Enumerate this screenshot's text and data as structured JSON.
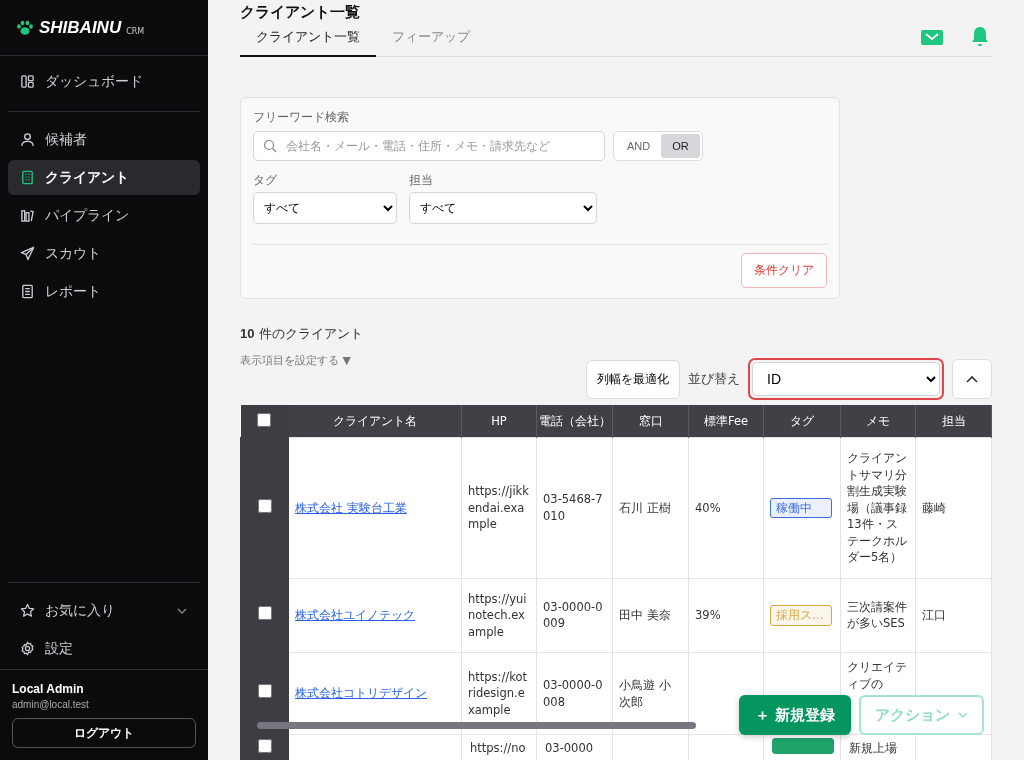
{
  "sidebar": {
    "logo": {
      "name": "SHIBAINU",
      "suffix": "CRM"
    },
    "top_items": [
      {
        "label": "ダッシュボード",
        "selected": false
      }
    ],
    "items": [
      {
        "label": "候補者",
        "selected": false
      },
      {
        "label": "クライアント",
        "selected": true
      },
      {
        "label": "パイプライン",
        "selected": false
      },
      {
        "label": "スカウト",
        "selected": false
      },
      {
        "label": "レポート",
        "selected": false
      }
    ],
    "bottom_items": [
      {
        "label": "お気に入り",
        "expandable": true
      },
      {
        "label": "設定",
        "expandable": false
      }
    ],
    "user": {
      "name": "Local Admin",
      "email": "admin@local.test",
      "logout": "ログアウト"
    }
  },
  "page": {
    "title": "クライアント一覧",
    "tabs": [
      {
        "label": "クライアント一覧",
        "selected": true
      },
      {
        "label": "フィーアップ",
        "selected": false
      }
    ]
  },
  "filters": {
    "search_label": "フリーワード検索",
    "search_placeholder": "会社名・メール・電話・住所・メモ・請求先など",
    "modes": [
      {
        "label": "AND",
        "selected": false
      },
      {
        "label": "OR",
        "selected": true
      }
    ],
    "selects": [
      {
        "label": "タグ",
        "value": "すべて"
      },
      {
        "label": "担当",
        "value": "すべて"
      }
    ],
    "clear": "条件クリア"
  },
  "results": {
    "count": "10",
    "count_label": "件のクライアント",
    "columns_toggle": "表示項目を設定する ▼",
    "autofit": "列幅を最適化",
    "sort_label": "並び替え",
    "sort_value": "ID"
  },
  "table": {
    "select_all_checked": false,
    "columns": [
      "クライアント名",
      "HP",
      "電話（会社）",
      "窓口",
      "標準Fee",
      "タグ",
      "メモ",
      "担当"
    ],
    "rows": [
      {
        "checked": false,
        "name": "株式会社 実験台工業",
        "hp": "https://jikkendai.example",
        "phone": "03-5468-7010",
        "contact": "石川 正樹",
        "fee": "40%",
        "tag": {
          "label": "稼働中",
          "color": "#3b6fe0"
        },
        "memo": "クライアントサマリ分割生成実験場（議事録13件・ステークホルダー5名）",
        "owner": "藤崎"
      },
      {
        "checked": false,
        "name": "株式会社ユイノテック",
        "hp": "https://yuinotech.example",
        "phone": "03-0000-0009",
        "contact": "田中 美奈",
        "fee": "39%",
        "tag": {
          "label": "採用ス…",
          "color": "#d9a640"
        },
        "memo": "三次請案件が多いSES",
        "owner": "江口"
      },
      {
        "checked": false,
        "name": "株式会社コトリデザイン",
        "hp": "https://kotridesign.example",
        "phone": "03-0000-0008",
        "contact": "小鳥遊 小次郎",
        "memo": "クリエイティブの"
      },
      {
        "checked": false,
        "hp": "https://no",
        "phone": "03-0000",
        "memo": "新規上場",
        "tag": {
          "color": "#1fa36b"
        }
      }
    ]
  },
  "actions": {
    "create_prefix": "＋",
    "create": "新規登録",
    "menu": "アクション"
  }
}
